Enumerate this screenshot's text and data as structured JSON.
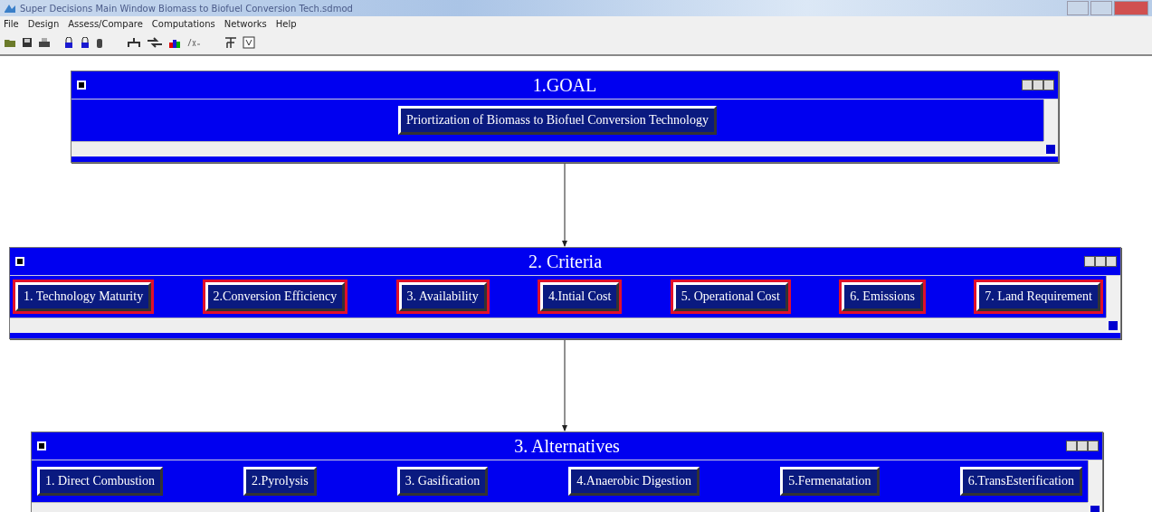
{
  "window": {
    "title": "Super Decisions Main Window Biomass to Biofuel Conversion Tech.sdmod"
  },
  "menu": [
    "File",
    "Design",
    "Assess/Compare",
    "Computations",
    "Networks",
    "Help"
  ],
  "clusters": [
    {
      "title": "1.GOAL",
      "nodes": [
        {
          "label": "Priortization of Biomass to Biofuel Conversion Technology",
          "highlighted": false
        }
      ]
    },
    {
      "title": "2. Criteria",
      "nodes": [
        {
          "label": "1. Technology Maturity",
          "highlighted": true
        },
        {
          "label": "2.Conversion Efficiency",
          "highlighted": true
        },
        {
          "label": "3. Availability",
          "highlighted": true
        },
        {
          "label": "4.Intial Cost",
          "highlighted": true
        },
        {
          "label": "5. Operational Cost",
          "highlighted": true
        },
        {
          "label": "6. Emissions",
          "highlighted": true
        },
        {
          "label": "7. Land Requirement",
          "highlighted": true
        }
      ]
    },
    {
      "title": "3. Alternatives",
      "nodes": [
        {
          "label": "1. Direct Combustion",
          "highlighted": false
        },
        {
          "label": "2.Pyrolysis",
          "highlighted": false
        },
        {
          "label": "3. Gasification",
          "highlighted": false
        },
        {
          "label": "4.Anaerobic Digestion",
          "highlighted": false
        },
        {
          "label": "5.Fermenatation",
          "highlighted": false
        },
        {
          "label": "6.TransEsterification",
          "highlighted": false
        }
      ]
    }
  ]
}
